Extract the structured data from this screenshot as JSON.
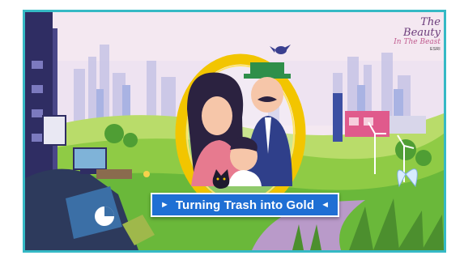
{
  "video": {
    "title": "Turning Trash into Gold",
    "arrow_left": "►",
    "arrow_right": "◄"
  },
  "brand": {
    "line1": "The Beauty",
    "line2": "In The Beast",
    "line3": "ESRI"
  },
  "colors": {
    "frame": "#35b9c5",
    "banner": "#1f6fd4",
    "ring": "#f2c500",
    "grass": "#7bc53a",
    "sky": "#f3e6f0"
  }
}
